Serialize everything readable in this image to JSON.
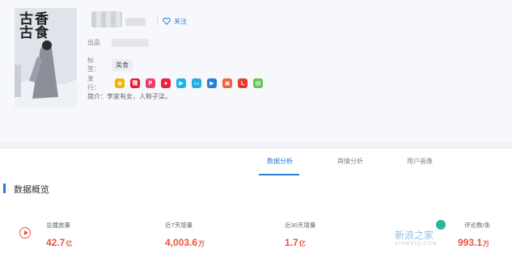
{
  "profile": {
    "cover_title": "古香古食",
    "follow_label": "关注",
    "publisher_label": "出品",
    "tags_label": "标签：",
    "tag": "美食",
    "release_label": "发行：",
    "intro_label": "简介：",
    "intro_text": "李家有女，人称子柒。"
  },
  "platforms": [
    {
      "icon": "bilibili-style-icon",
      "color": "#f5b400",
      "glyph": "◉"
    },
    {
      "icon": "weibo-icon",
      "color": "#e6162d",
      "glyph": "微"
    },
    {
      "icon": "huajiao-icon",
      "color": "#ef3e6c",
      "glyph": "P"
    },
    {
      "icon": "youku-icon",
      "color": "#e8233c",
      "glyph": "●"
    },
    {
      "icon": "tencent-video-icon",
      "color": "#19b3f0",
      "glyph": "▶"
    },
    {
      "icon": "bilibili-tv-icon",
      "color": "#23ade5",
      "glyph": "▭"
    },
    {
      "icon": "iqiyi-icon",
      "color": "#2a7bd5",
      "glyph": "▶"
    },
    {
      "icon": "xigua-icon",
      "color": "#f2603b",
      "glyph": "▣"
    },
    {
      "icon": "le-icon",
      "color": "#e63b2e",
      "glyph": "L"
    },
    {
      "icon": "pptv-icon",
      "color": "#6ac259",
      "glyph": "▤"
    }
  ],
  "tabs": [
    {
      "label": "数据分析",
      "active": true
    },
    {
      "label": "舆情分析",
      "active": false
    },
    {
      "label": "用户画像",
      "active": false
    }
  ],
  "overview": {
    "title": "数据概览",
    "stats": [
      {
        "label": "总播放量",
        "value": "42.7",
        "unit": "亿"
      },
      {
        "label": "近7天增量",
        "value": "4,003.6",
        "unit": "万"
      },
      {
        "label": "近30天增量",
        "value": "1.7",
        "unit": "亿"
      },
      {
        "label": "评论数/条",
        "value": "993.1",
        "unit": "万"
      }
    ]
  },
  "watermark": {
    "text": "新浪之家",
    "sub": "XINWEIQ.COM"
  },
  "colors": {
    "accent": "#2a7bd5",
    "highlight": "#e8533f"
  }
}
